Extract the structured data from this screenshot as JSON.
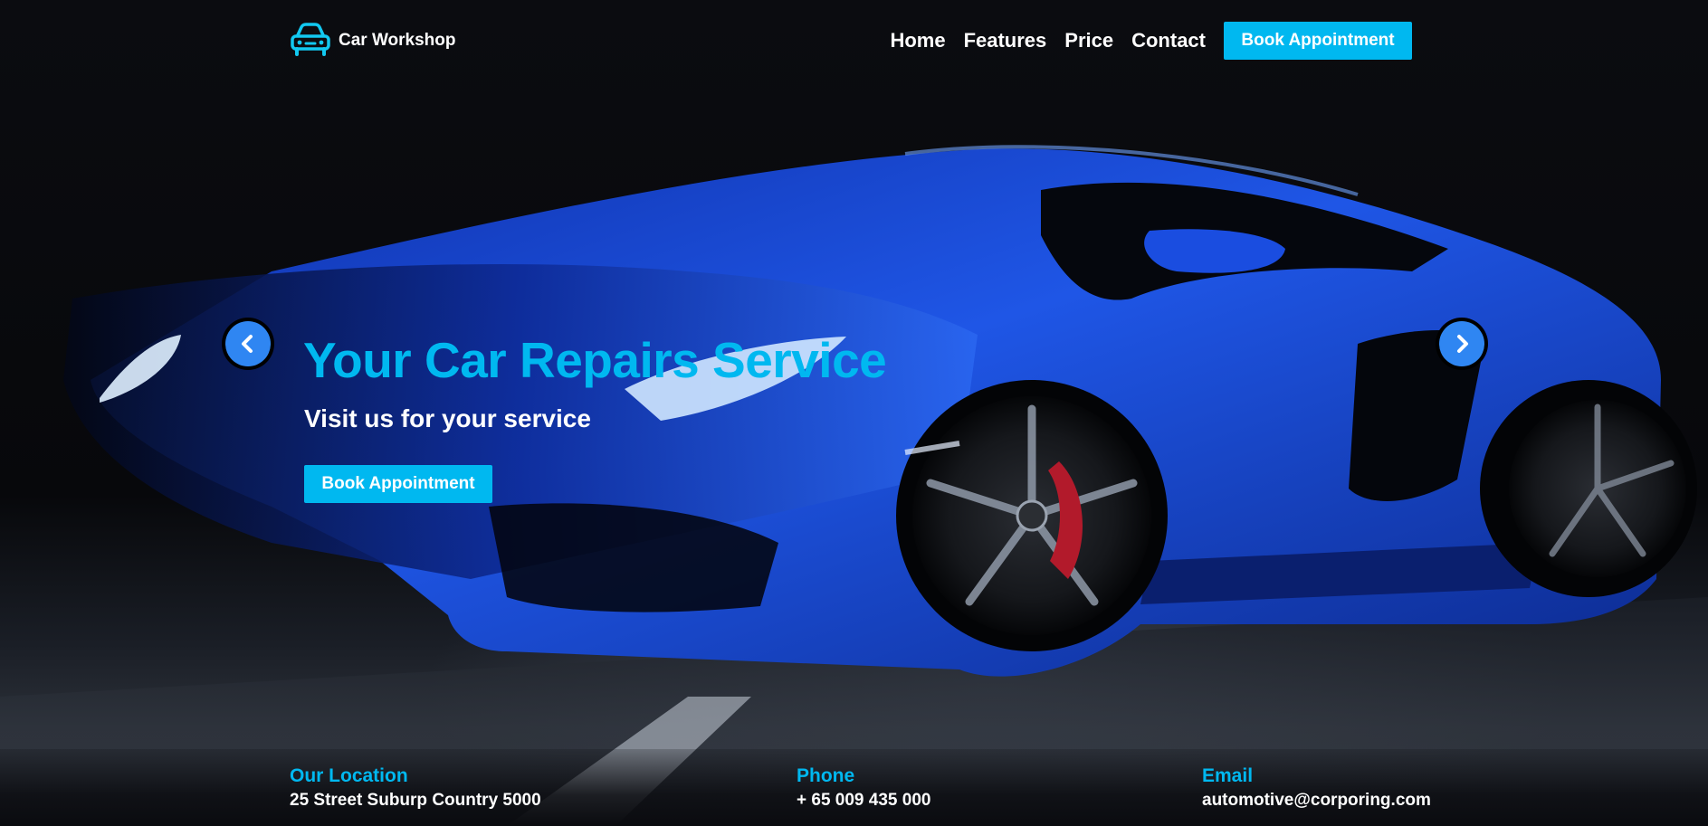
{
  "header": {
    "brand_name": "Car Workshop",
    "brand_icon": "car-icon",
    "nav": [
      {
        "label": "Home"
      },
      {
        "label": "Features"
      },
      {
        "label": "Price"
      },
      {
        "label": "Contact"
      }
    ],
    "cta_label": "Book Appointment"
  },
  "hero": {
    "title": "Your Car Repairs Service",
    "subtitle": "Visit us for your service",
    "cta_label": "Book Appointment",
    "prev_icon": "chevron-left-icon",
    "next_icon": "chevron-right-icon"
  },
  "contact": {
    "location": {
      "label": "Our Location",
      "value": "25 Street Suburp Country 5000"
    },
    "phone": {
      "label": "Phone",
      "value": "+ 65 009 435 000"
    },
    "email": {
      "label": "Email",
      "value": "automotive@corporing.com"
    }
  },
  "colors": {
    "accent": "#00b8f0",
    "arrow": "#2f86f2",
    "car_body": "#1f4fd6",
    "background": "#0a0b0f"
  }
}
